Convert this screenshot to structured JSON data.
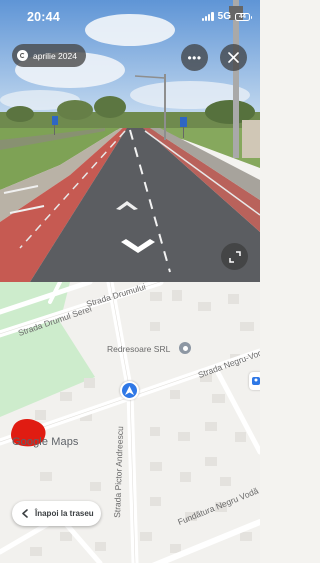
{
  "status_bar": {
    "time": "20:44",
    "network": "5G",
    "battery": "44"
  },
  "street_view": {
    "date_label": "aprilie 2024",
    "more_button_label": "•••",
    "icons": [
      "calendar-icon",
      "more-icon",
      "close-icon",
      "nav-arrow-icon",
      "expand-icon"
    ]
  },
  "map": {
    "street_labels": {
      "drumul_serei": "Strada Drumul Serei",
      "drumului": "Strada Drumului",
      "pictor_andreescu": "Strada Pictor Andreescu",
      "negru_voda": "Strada Negru-Vodă",
      "fundatura_negru_voda": "Fundătura Negru Vodă"
    },
    "poi_label": "Redresoare SRL",
    "logo_text": "Google Maps",
    "back_button_label": "Înapoi la traseu"
  },
  "colors": {
    "bike_lane": "#c65a52",
    "map_background": "#f2f1ee",
    "park_green": "#cdeccc",
    "pegman_blue": "#2f78e6",
    "redaction": "#e01c12"
  }
}
